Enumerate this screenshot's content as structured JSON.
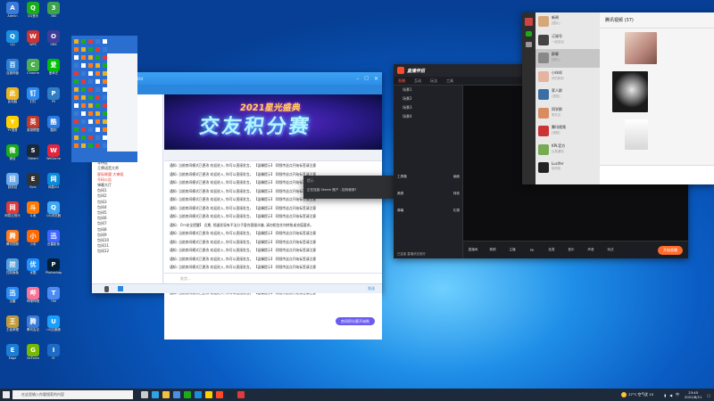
{
  "taskbar": {
    "search_placeholder": "在这里输入你要搜索的内容",
    "weather": "27°C 空气优 15",
    "time": "23:45",
    "date": "2021/8/11"
  },
  "desktop": {
    "icons": [
      "Admin",
      "QQ",
      "百度网盘",
      "此电脑",
      "YY语音",
      "微信",
      "回收站",
      "网易云音乐",
      "腾讯视频",
      "控制面板",
      "迅雷",
      "王者荣耀",
      "Edge",
      "QQ音乐",
      "WPS",
      "Chrome",
      "钉钉",
      "英雄联盟",
      "Steam",
      "Epic",
      "斗鱼",
      "小米",
      "优酷",
      "哔哩哔哩",
      "腾讯会议",
      "GeForce",
      "360",
      "OBS",
      "爱奇艺",
      "PS",
      "酷狗",
      "WeGame",
      "网易UU",
      "QQ浏览器",
      "迅雷影音",
      "Photoshop",
      "TIM",
      "UU加速器",
      "IE"
    ]
  },
  "yy": {
    "title": "频道名称",
    "channel_id": "ID:44444",
    "left_items": [
      "频道-马戏",
      "天王猫",
      "星辰组",
      "1号主播",
      "房管",
      "小天使",
      "管理1",
      "管理2",
      "灰烬",
      "荣耀团",
      "传奇之战",
      "回归大厅",
      "等待区",
      "王牌语音大师",
      "星际联盟 大神组",
      "号码公告",
      "弹幕大厅",
      "包间1",
      "包间2",
      "包间3",
      "包间4",
      "包间5",
      "包间6",
      "包间7",
      "包间8",
      "包间9",
      "包间10",
      "包间11",
      "包间12"
    ],
    "banner_top": "2021星光盛典",
    "banner_main": "交友积分赛",
    "messages": [
      "通知: 当前房间模式已更改 欢迎进入, 你可以直接发言。 【温馨提示】 同频传送点开始标签请注意",
      "通知: 当前房间模式已更改 欢迎进入, 你可以直接发言。 【温馨提示】 同频传送点开始标签请注意",
      "通知: 当前房间模式已更改 欢迎进入, 你可以直接发言。 【温馨提示】 同频传送点开始标签请注意",
      "通知: 当前房间模式已更改 欢迎进入, 你可以直接发言。 【温馨提示】 同频传送点开始标签请注意",
      "通知: 当前房间模式已更改 欢迎进入, 你可以直接发言。 【温馨提示】 同频传送点开始标签请注意",
      "通知: 当前房间模式已更改 欢迎进入, 你可以直接发言。 【温馨提示】 同频传送点开始标签请注意",
      "通知: 当前房间模式已更改 欢迎进入, 你可以直接发言。 【温馨提示】 同频传送点开始标签请注意",
      "通知: 【YY安全提醒】 近期, 频道发现有不法分子冒充客服诈骗, 请勿相信任何转账或充值要求。",
      "通知: 当前房间模式已更改 欢迎进入, 你可以直接发言。 【温馨提示】 同频传送点开始标签请注意",
      "通知: 当前房间模式已更改 欢迎进入, 你可以直接发言。 【温馨提示】 同频传送点开始标签请注意",
      "通知: 当前房间模式已更改 欢迎进入, 你可以直接发言。 【温馨提示】 同频传送点开始标签请注意",
      "通知: 当前房间模式已更改 欢迎进入, 你可以直接发言。 【温馨提示】 同频传送点开始标签请注意",
      "通知: 当前房间模式已更改 欢迎进入, 你可以直接发言。 【温馨提示】 同频传送点开始标签请注意",
      "通知: 当前房间模式已更改 欢迎进入, 你可以直接发言。 【温馨提示】 同频传送点开始标签请注意",
      "通知: 当前房间模式已更改 欢迎进入, 你可以直接发言。 【温馨提示】 同频传送点开始标签请注意",
      "通知: 当前房间模式已更改 欢迎进入, 你可以直接发言。 【温馨提示】 同频传送点开始标签请注意"
    ],
    "bubble": "房间积分赛开始啦",
    "input_placeholder": "发言...",
    "send_label": "发送"
  },
  "live": {
    "title": "直播伴侣",
    "tabs": [
      "直播",
      "互动",
      "玩法",
      "工具"
    ],
    "scenes": [
      "场景1",
      "场景2",
      "场景3",
      "场景4"
    ],
    "tools": [
      "工具箱",
      "画面",
      "美颜",
      "特效",
      "弹幕",
      "礼物"
    ],
    "controls": [
      "直播间",
      "美颜",
      "主播",
      "PK",
      "连麦",
      "音乐",
      "声音",
      "玩法"
    ],
    "go_label": "开始直播",
    "status": "已连接 直播状态良好"
  },
  "popup": {
    "title": "提示",
    "text": "正在连接 Steam 账户 - 如何使用?"
  },
  "wechat": {
    "title": "腾讯视频 (37)",
    "chats": [
      {
        "name": "新闻",
        "sub": "[图片]"
      },
      {
        "name": "订阅号",
        "sub": "一起加油"
      },
      {
        "name": "群聊",
        "sub": "[图片]"
      },
      {
        "name": "小伙伴",
        "sub": "好的收到"
      },
      {
        "name": "家人群",
        "sub": "[语音]"
      },
      {
        "name": "同学群",
        "sub": "明天见"
      },
      {
        "name": "腾讯视频",
        "sub": "[视频]"
      },
      {
        "name": "KPL官方",
        "sub": "比赛通知"
      },
      {
        "name": "Lucifer",
        "sub": "哈哈哈"
      }
    ]
  }
}
